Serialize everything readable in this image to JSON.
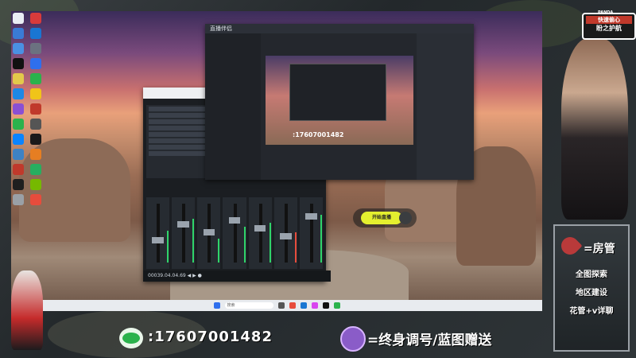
{
  "overlay": {
    "panda_name": "PANDA",
    "tag_line1": "快速偷心",
    "tag_line2": "盼之护航",
    "panel_big": "=房管",
    "panel_lines": [
      "全图探索",
      "地区建设",
      "花管+v详聊"
    ],
    "contact_number": ":17607001482",
    "slogan": "=终身调号/蓝图赠送"
  },
  "obs": {
    "title": "直播伴侣",
    "preview_phone": ":17607001482",
    "go_live_label": "开始直播"
  },
  "mixer": {
    "timecode": "00039.04.04.69"
  },
  "taskbar": {
    "search_placeholder": "搜索"
  },
  "colors": {
    "accent_yellow": "#e4ef2f",
    "wechat_green": "#2bb24c",
    "meter_green": "#2fd46a",
    "badge_purple": "#8a5cc8"
  }
}
